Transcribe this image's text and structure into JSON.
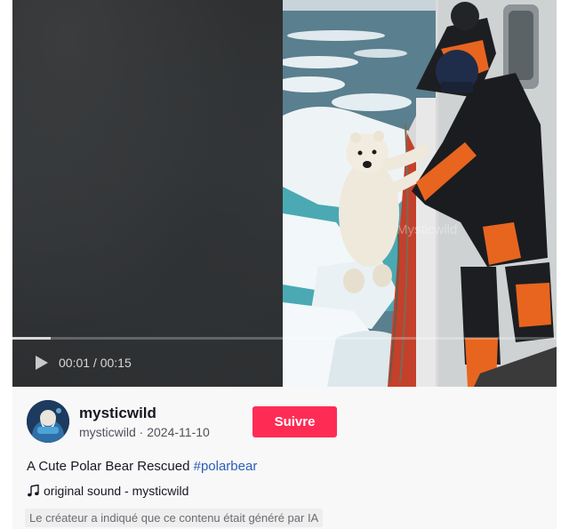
{
  "video": {
    "current_time": "00:01",
    "separator": " / ",
    "duration": "00:15",
    "progress": 0.07,
    "watermark": "Mysticwild"
  },
  "author": {
    "display_name": "mysticwild",
    "username": "mysticwild",
    "date_separator": " · ",
    "date": "2024-11-10"
  },
  "follow_label": "Suivre",
  "description": {
    "text": "A Cute Polar Bear Rescued ",
    "hashtag": "#polarbear"
  },
  "sound": {
    "icon": "music-note-icon",
    "label": "original sound - mysticwild"
  },
  "ai_label": "Le créateur a indiqué que ce contenu était généré par IA",
  "colors": {
    "follow_button": "#fe2c55",
    "hashtag": "#2b5db9",
    "video_background": "#2b2c2e"
  }
}
